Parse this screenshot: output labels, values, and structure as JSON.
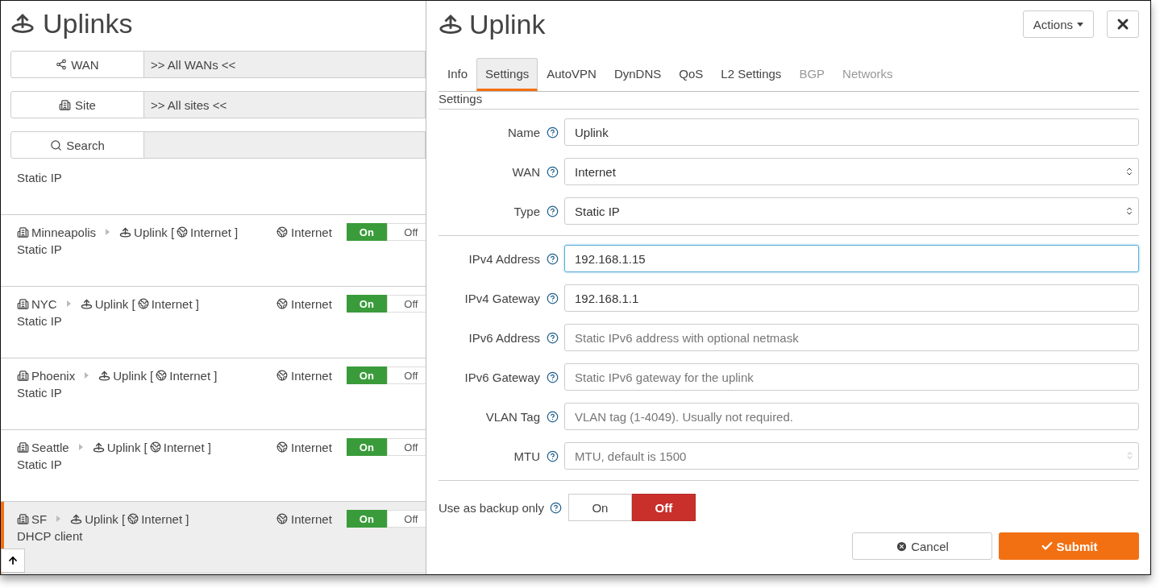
{
  "list_panel": {
    "title": "Uplinks",
    "filters": [
      {
        "kind": "wan",
        "label": "WAN",
        "value": ">> All WANs <<"
      },
      {
        "kind": "site",
        "label": "Site",
        "value": ">> All sites <<"
      },
      {
        "kind": "search",
        "label": "Search"
      }
    ],
    "partial_row": {
      "detail": "Static IP"
    },
    "rows": [
      {
        "site": "Minneapolis",
        "uplink": "Uplink [",
        "uplink_wan": "Internet ]",
        "wan": "Internet",
        "on_label": "On",
        "off_label": "Off",
        "enabled": true,
        "detail": "Static IP",
        "selected": false
      },
      {
        "site": "NYC",
        "uplink": "Uplink [",
        "uplink_wan": "Internet ]",
        "wan": "Internet",
        "on_label": "On",
        "off_label": "Off",
        "enabled": true,
        "detail": "Static IP",
        "selected": false
      },
      {
        "site": "Phoenix",
        "uplink": "Uplink [",
        "uplink_wan": "Internet ]",
        "wan": "Internet",
        "on_label": "On",
        "off_label": "Off",
        "enabled": true,
        "detail": "Static IP",
        "selected": false
      },
      {
        "site": "Seattle",
        "uplink": "Uplink [",
        "uplink_wan": "Internet ]",
        "wan": "Internet",
        "on_label": "On",
        "off_label": "Off",
        "enabled": true,
        "detail": "Static IP",
        "selected": false
      },
      {
        "site": "SF",
        "uplink": "Uplink [",
        "uplink_wan": "Internet ]",
        "wan": "Internet",
        "on_label": "On",
        "off_label": "Off",
        "enabled": true,
        "detail": "DHCP client",
        "selected": true
      }
    ]
  },
  "detail_panel": {
    "title": "Uplink",
    "actions": "Actions",
    "tabs": [
      {
        "label": "Info",
        "selected": false,
        "disabled": false
      },
      {
        "label": "Settings",
        "selected": true,
        "disabled": false
      },
      {
        "label": "AutoVPN",
        "selected": false,
        "disabled": false
      },
      {
        "label": "DynDNS",
        "selected": false,
        "disabled": false
      },
      {
        "label": "QoS",
        "selected": false,
        "disabled": false
      },
      {
        "label": "L2 Settings",
        "selected": false,
        "disabled": false
      },
      {
        "label": "BGP",
        "selected": false,
        "disabled": true
      },
      {
        "label": "Networks",
        "selected": false,
        "disabled": true
      }
    ],
    "section": "Settings",
    "groups": [
      [
        {
          "label": "Name",
          "kind": "text",
          "value": "Uplink",
          "focused": false
        },
        {
          "label": "WAN",
          "kind": "select",
          "value": "Internet",
          "focused": false
        },
        {
          "label": "Type",
          "kind": "select",
          "value": "Static IP",
          "focused": false
        }
      ],
      [
        {
          "label": "IPv4 Address",
          "kind": "text",
          "value": "192.168.1.15",
          "focused": true
        },
        {
          "label": "IPv4 Gateway",
          "kind": "text",
          "value": "192.168.1.1",
          "focused": false
        },
        {
          "label": "IPv6 Address",
          "kind": "text",
          "placeholder": "Static IPv6 address with optional netmask",
          "focused": false
        },
        {
          "label": "IPv6 Gateway",
          "kind": "text",
          "placeholder": "Static IPv6 gateway for the uplink",
          "focused": false
        },
        {
          "label": "VLAN Tag",
          "kind": "text",
          "placeholder": "VLAN tag (1-4049). Usually not required.",
          "focused": false
        },
        {
          "label": "MTU",
          "kind": "number",
          "placeholder": "MTU, default is 1500",
          "focused": false
        }
      ]
    ],
    "backup": {
      "label": "Use as backup only",
      "options": [
        {
          "label": "On",
          "selected": false
        },
        {
          "label": "Off",
          "selected": true
        }
      ]
    },
    "cancel": "Cancel",
    "submit": "Submit"
  }
}
